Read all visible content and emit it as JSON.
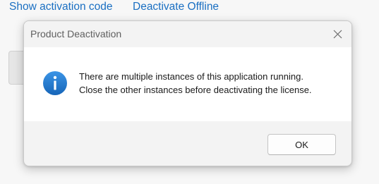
{
  "background": {
    "links": {
      "show_activation_code": "Show activation code",
      "deactivate_offline": "Deactivate Offline"
    }
  },
  "dialog": {
    "title": "Product Deactivation",
    "icon": "info-icon",
    "message_lines": [
      "There are multiple instances of this application running.",
      "Close the other instances before deactivating the license."
    ],
    "ok_label": "OK"
  },
  "colors": {
    "link": "#1a6fc2",
    "info_icon": "#1f7ad0",
    "content_bg": "#ffffff",
    "dialog_bg": "#f3f3f3"
  }
}
